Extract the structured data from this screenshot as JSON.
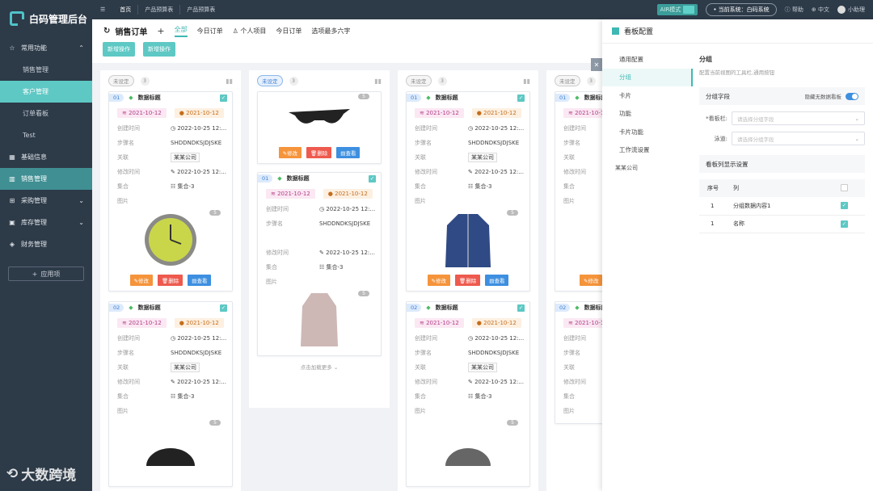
{
  "app": {
    "title": "白码管理后台"
  },
  "sidebar": {
    "items": [
      {
        "label": "常用功能",
        "icon": "star-icon",
        "chev": "⌃"
      },
      {
        "label": "销售管理"
      },
      {
        "label": "客户管理"
      },
      {
        "label": "订单看板"
      },
      {
        "label": "Test"
      },
      {
        "label": "基础信息",
        "icon": "grid-icon"
      },
      {
        "label": "销售管理",
        "icon": "chart-icon"
      },
      {
        "label": "采购管理",
        "icon": "cart-icon",
        "chev": "⌄"
      },
      {
        "label": "库存管理",
        "icon": "box-icon",
        "chev": "⌄"
      },
      {
        "label": "财务管理",
        "icon": "wallet-icon"
      }
    ],
    "add_app": "应用项"
  },
  "topbar": {
    "tabs": [
      "首页",
      "产品预算表",
      "产品预算表"
    ],
    "air": "AIR模式",
    "system": "当前系统：白码系统",
    "help": "帮助",
    "lang": "中文",
    "user": "小助理"
  },
  "header": {
    "title": "销售订单",
    "filters": [
      "全部",
      "今日订单",
      "个人项目",
      "今日订单",
      "选项最多六字"
    ],
    "buttons": [
      "新增操作",
      "新增操作"
    ]
  },
  "board": {
    "status": "未设定",
    "count": "3",
    "field_labels": {
      "created": "创建时间",
      "step": "步骤名",
      "rel": "关联",
      "modified": "修改时间",
      "set": "集合",
      "image": "图片"
    },
    "values": {
      "date1": "2021-10-12",
      "date2": "2021-10-12",
      "created": "2022-10-25  12:...",
      "step": "SHDDNDKSJDJSKE",
      "rel": "某某公司",
      "modified": "2022-10-25  12:...",
      "set": "集合-3"
    },
    "card_title": "数据标题",
    "nums": [
      "01",
      "02"
    ],
    "img_count": "5",
    "actions": {
      "edit": "修改",
      "del": "删除",
      "view": "查看"
    },
    "loadmore": "点击加载更多"
  },
  "drawer": {
    "title": "看板配置",
    "nav": [
      "通用配置",
      "分组",
      "卡片",
      "功能",
      "卡片功能",
      "工作流设置"
    ],
    "company": "某某公司",
    "section_title": "分组",
    "section_desc": "配置当前视图的工具栏,通用按钮",
    "group_field": "分组字段",
    "hide_empty": "隐藏无数据看板",
    "field1_label": "*看板栏:",
    "field2_label": "泳道:",
    "placeholder": "请选择分组字段",
    "display_title": "看板列显示设置",
    "table_headers": [
      "序号",
      "列"
    ],
    "rows": [
      {
        "no": "1",
        "col": "分组数据内容1"
      },
      {
        "no": "1",
        "col": "名称"
      }
    ]
  },
  "watermark": "大数跨境",
  "colors": {
    "accent": "#5ec8c4",
    "sidebar": "#2d3a48"
  }
}
